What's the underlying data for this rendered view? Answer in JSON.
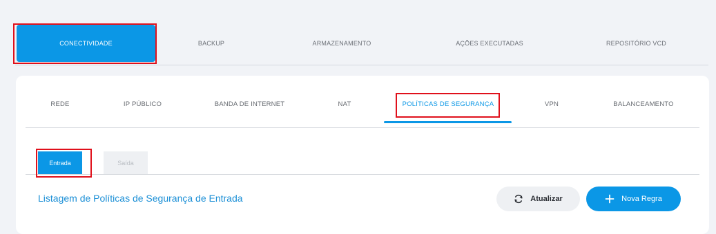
{
  "top_tabs": [
    {
      "label": "CONECTIVIDADE",
      "active": true
    },
    {
      "label": "BACKUP",
      "active": false
    },
    {
      "label": "ARMAZENAMENTO",
      "active": false
    },
    {
      "label": "AÇÕES EXECUTADAS",
      "active": false
    },
    {
      "label": "REPOSITÓRIO VCD",
      "active": false
    }
  ],
  "sub_tabs": [
    {
      "label": "REDE",
      "active": false
    },
    {
      "label": "IP PÚBLICO",
      "active": false
    },
    {
      "label": "BANDA DE INTERNET",
      "active": false
    },
    {
      "label": "NAT",
      "active": false
    },
    {
      "label": "POLÍTICAS DE SEGURANÇA",
      "active": true
    },
    {
      "label": "VPN",
      "active": false
    },
    {
      "label": "BALANCEAMENTO",
      "active": false
    }
  ],
  "direction_tabs": [
    {
      "label": "Entrada",
      "active": true
    },
    {
      "label": "Saída",
      "active": false
    }
  ],
  "list_title": "Listagem de Políticas de Segurança de Entrada",
  "buttons": {
    "refresh": {
      "label": "Atualizar",
      "icon": "refresh-icon"
    },
    "new_rule": {
      "label": "Nova Regra",
      "icon": "plus-icon"
    }
  },
  "colors": {
    "accent": "#0b97e6",
    "highlight": "#e0101b",
    "background": "#f1f3f7"
  }
}
